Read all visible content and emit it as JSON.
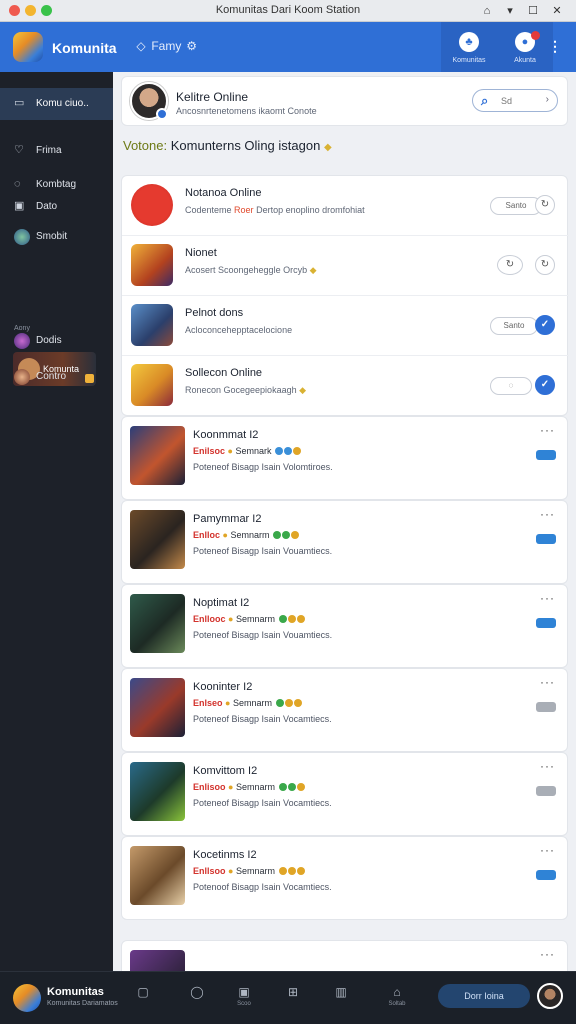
{
  "window": {
    "title": "Komunitas Dari Koom Station"
  },
  "header": {
    "app_name": "Komunita",
    "nav_label": "Famy",
    "buttons": [
      {
        "label": "Komunitas",
        "icon": "community-icon"
      },
      {
        "label": "Akunta",
        "icon": "notification-icon"
      }
    ]
  },
  "sidebar": {
    "items": [
      {
        "label": "Komu ciuo..",
        "icon": "home-icon"
      },
      {
        "label": "Frima",
        "icon": "heart-icon"
      },
      {
        "label": "Kombtag",
        "icon": "chat-icon"
      },
      {
        "label": "Dato",
        "icon": "calendar-icon"
      },
      {
        "label": "Smobit",
        "icon": "game-avatar-icon"
      },
      {
        "label": "Dodis",
        "icon": "game-avatar-icon"
      },
      {
        "label": "Contro",
        "icon": "game-avatar-icon"
      }
    ],
    "sub_label": "Aony",
    "featured": {
      "label": "Komunta"
    }
  },
  "profile": {
    "name": "Kelitre Online",
    "subtitle": "Ancosnrtenetomens ikaomt Conote",
    "search_placeholder": "Sd"
  },
  "section_title": {
    "prefix": "Votone:",
    "text": "Komunterns Oling istagon"
  },
  "friends": [
    {
      "name": "Notanoa Online",
      "sub": "Codenteme",
      "sub_warn": "Roer",
      "sub_rest": "Dertop enoplino dromfohiat",
      "pill": "Santo",
      "pill_width": 52,
      "circle": "↻",
      "circle_on": false
    },
    {
      "name": "Nionet",
      "sub": "Acosert Scoongeheggle Orcyb",
      "sub_warn": "",
      "sub_rest": "",
      "pill": "",
      "pill_width": 0,
      "circle": "↻",
      "circle_on": false
    },
    {
      "name": "Pelnot dons",
      "sub": "Acloconcehepptacelocione",
      "sub_warn": "",
      "sub_rest": "",
      "pill": "Santo",
      "pill_width": 48,
      "circle": "✓",
      "circle_on": true
    },
    {
      "name": "Sollecon Online",
      "sub": "Ronecon Gocegeepiokaagh",
      "sub_warn": "",
      "sub_rest": "",
      "pill": "",
      "pill_width": 42,
      "circle": "✓",
      "circle_on": true
    }
  ],
  "games": [
    {
      "title": "Koonmmat I2",
      "tag": "Enilsoc",
      "meta": "Semnark",
      "desc": "Poteneof Bisagp Isain Volomtiroes.",
      "status": "blue"
    },
    {
      "title": "Pamymmar I2",
      "tag": "Enlloc",
      "meta": "Semnarm",
      "desc": "Poteneof Bisagp Isain Vouamtiecs.",
      "status": "blue"
    },
    {
      "title": "Noptimat I2",
      "tag": "Enllooc",
      "meta": "Semnarm",
      "desc": "Poteneof Bisagp Isain Vouamtiecs.",
      "status": "blue"
    },
    {
      "title": "Kooninter I2",
      "tag": "Enlseo",
      "meta": "Semnarm",
      "desc": "Poteneof Bisagp Isain Vocamtiecs.",
      "status": "grey"
    },
    {
      "title": "Komvittom I2",
      "tag": "Enlisoo",
      "meta": "Semnarm",
      "desc": "Poteneof Bisagp Isain Vocamtiecs.",
      "status": "grey"
    },
    {
      "title": "Kocetinms I2",
      "tag": "Enllsoo",
      "meta": "Semnarm",
      "desc": "Potenoof Bisagp Isain Vocamtiecs.",
      "status": "blue"
    }
  ],
  "bottom": {
    "name": "Komunitas",
    "sub": "Komunitas Dariamatos",
    "icons": [
      "chat-icon",
      "globe-icon",
      "calendar-icon",
      "grid-icon",
      "columns-icon",
      "profile-icon"
    ],
    "icon_labels": [
      "",
      "",
      "Scoo",
      "",
      "",
      "Soltab"
    ],
    "cta": "Dorr Ioina"
  }
}
